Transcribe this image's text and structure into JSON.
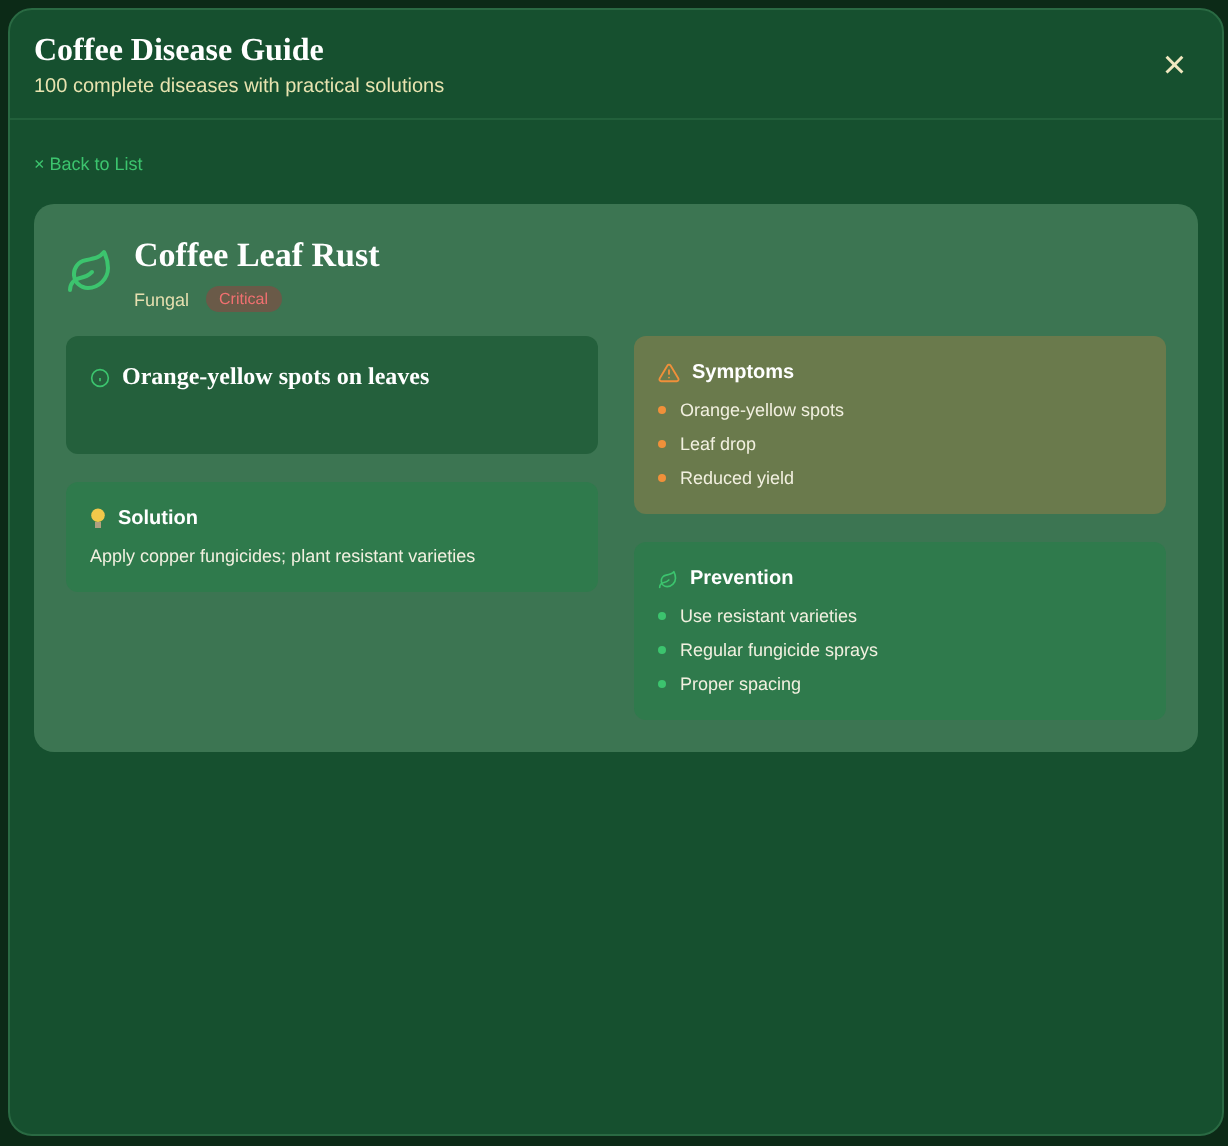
{
  "header": {
    "title": "Coffee Disease Guide",
    "subtitle": "100 complete diseases with practical solutions",
    "close": "×"
  },
  "back_link": {
    "icon": "×",
    "label": "Back to List"
  },
  "disease": {
    "name": "Coffee Leaf Rust",
    "category": "Fungal",
    "severity": "Critical",
    "summary": "Orange-yellow spots on leaves",
    "solution": {
      "title": "Solution",
      "text": "Apply copper fungicides; plant resistant varieties"
    },
    "sections": [
      {
        "kind": "symptoms",
        "title": "Symptoms",
        "items": [
          "Orange-yellow spots",
          "Leaf drop",
          "Reduced yield"
        ]
      },
      {
        "kind": "prevention",
        "title": "Prevention",
        "items": [
          "Use resistant varieties",
          "Regular fungicide sprays",
          "Proper spacing"
        ]
      }
    ]
  }
}
